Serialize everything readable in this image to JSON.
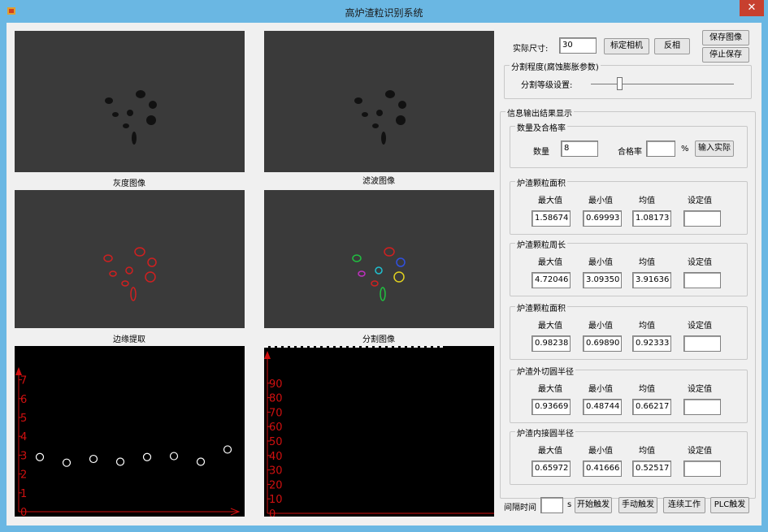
{
  "window": {
    "title": "高炉渣粒识别系统",
    "close_glyph": "✕"
  },
  "images": {
    "captions": [
      "灰度图像",
      "滤波图像",
      "边缘提取",
      "分割图像"
    ]
  },
  "plots": {
    "left_y_ticks": [
      "7",
      "6",
      "5",
      "4",
      "3",
      "2",
      "1",
      "0"
    ],
    "right_y_ticks": [
      "90",
      "80",
      "70",
      "60",
      "50",
      "40",
      "30",
      "20",
      "10",
      "0"
    ]
  },
  "chart_data": [
    {
      "type": "scatter",
      "title": "",
      "xlabel": "",
      "ylabel": "",
      "ylim": [
        0,
        7.5
      ],
      "series": [
        {
          "values": [
            2.9,
            2.6,
            2.8,
            2.65,
            2.9,
            2.95,
            2.65,
            3.3
          ]
        }
      ]
    },
    {
      "type": "bar",
      "title": "",
      "xlabel": "",
      "ylabel": "",
      "ylim": [
        0,
        100
      ],
      "series": []
    }
  ],
  "toolbar": {
    "size_label": "实际尺寸:",
    "size_value": "30",
    "calibrate": "标定相机",
    "invert": "反相",
    "save_image": "保存图像",
    "stop_save": "停止保存"
  },
  "segmentation": {
    "legend": "分割程度(腐蚀膨胀参数)",
    "label": "分割等级设置:",
    "level": 0.2
  },
  "info": {
    "legend": "信息输出结果显示",
    "count_group": {
      "legend": "数量及合格率",
      "count_label": "数量",
      "count_value": "8",
      "rate_label": "合格率",
      "rate_value": "",
      "percent": "%",
      "input_button": "输入实际"
    },
    "col_headers": [
      "最大值",
      "最小值",
      "均值",
      "设定值"
    ],
    "groups": [
      {
        "legend": "炉渣颗粒面积",
        "max": "1.58674",
        "min": "0.69993",
        "mean": "1.08173",
        "set": ""
      },
      {
        "legend": "炉渣颗粒周长",
        "max": "4.72046",
        "min": "3.09350",
        "mean": "3.91636",
        "set": ""
      },
      {
        "legend": "炉渣颗粒面积",
        "max": "0.98238",
        "min": "0.69890",
        "mean": "0.92333",
        "set": ""
      },
      {
        "legend": "炉渣外切圆半径",
        "max": "0.93669",
        "min": "0.48744",
        "mean": "0.66217",
        "set": ""
      },
      {
        "legend": "炉渣内接圆半径",
        "max": "0.65972",
        "min": "0.41666",
        "mean": "0.52517",
        "set": ""
      }
    ]
  },
  "bottom": {
    "interval_label": "间隔时间",
    "interval_value": "",
    "unit": "s",
    "start_trigger": "开始触发",
    "manual_trigger": "手动触发",
    "continuous": "连续工作",
    "plc_trigger": "PLC触发"
  }
}
